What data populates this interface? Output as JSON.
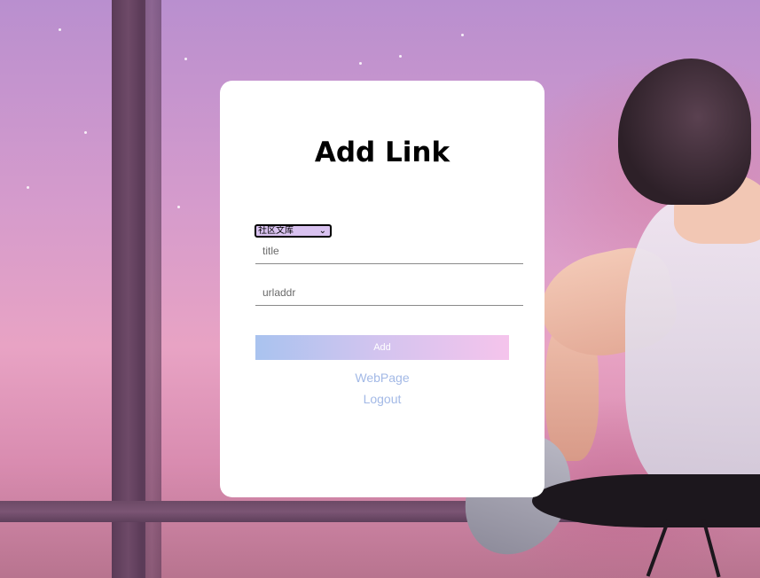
{
  "page": {
    "title": "Add Link"
  },
  "form": {
    "category_selected": "社区文库",
    "title_placeholder": "title",
    "url_placeholder": "urladdr",
    "submit_label": "Add"
  },
  "links": {
    "webpage_label": "WebPage",
    "logout_label": "Logout"
  },
  "colors": {
    "card_bg": "#ffffff",
    "button_gradient_start": "#a9c3ef",
    "button_gradient_end": "#f5c4ec",
    "link_color": "#a3b9e6"
  },
  "icons": {
    "select_arrow": "chevron-down-icon"
  }
}
